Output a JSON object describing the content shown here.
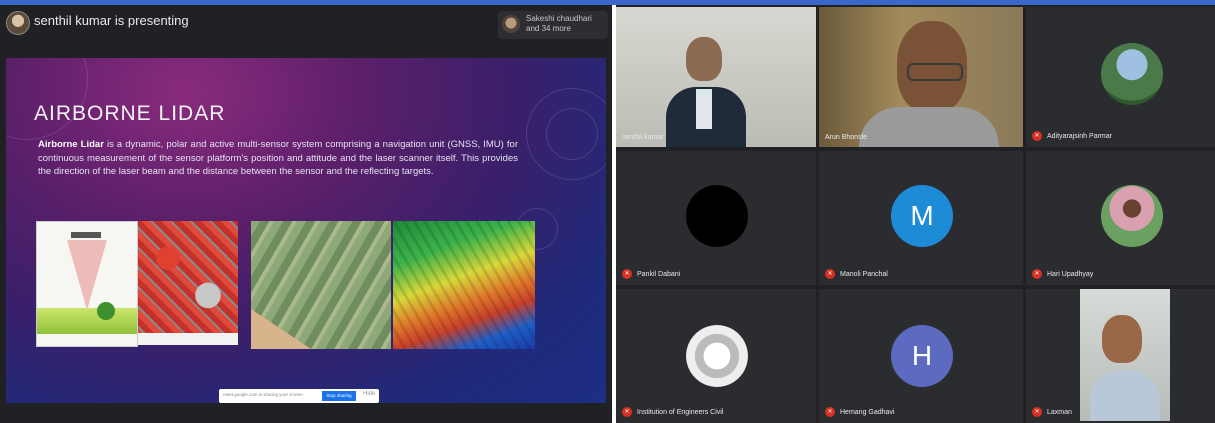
{
  "presenter": {
    "label": "senthil kumar is presenting",
    "viewers_text": "Sakeshi chaudhari and 34 more"
  },
  "slide": {
    "title": "AIRBORNE LIDAR",
    "body_bold": "Airborne Lidar",
    "body_rest": " is a dynamic, polar and active multi-sensor system comprising a navigation unit (GNSS, IMU) for continuous measurement of the sensor platform's position and attitude and the laser scanner itself. This provides the direction of the laser beam and the distance between the sensor and the reflecting targets.",
    "bar_text": "meet.google.com is sharing your screen",
    "bar_button": "Stop sharing",
    "bar_close": "Hide"
  },
  "participants": [
    {
      "name": "senthil kumar",
      "muted": false
    },
    {
      "name": "Arun Bhonsle",
      "muted": false
    },
    {
      "name": "Adityarajsinh Parmar",
      "muted": true
    },
    {
      "name": "Pankil Dabani",
      "muted": true
    },
    {
      "name": "Manoli Panchal",
      "muted": true,
      "initial": "M"
    },
    {
      "name": "Hari Upadhyay",
      "muted": true
    },
    {
      "name": "Institution of Engineers Civil",
      "muted": true
    },
    {
      "name": "Hemang Gadhavi",
      "muted": true,
      "initial": "H"
    },
    {
      "name": "Laxman",
      "muted": true
    }
  ],
  "colors": {
    "accent": "#3b68c8",
    "muted_mic": "#d93025",
    "avatar_m": "#1e8bd6",
    "avatar_h": "#5c6bc0"
  }
}
